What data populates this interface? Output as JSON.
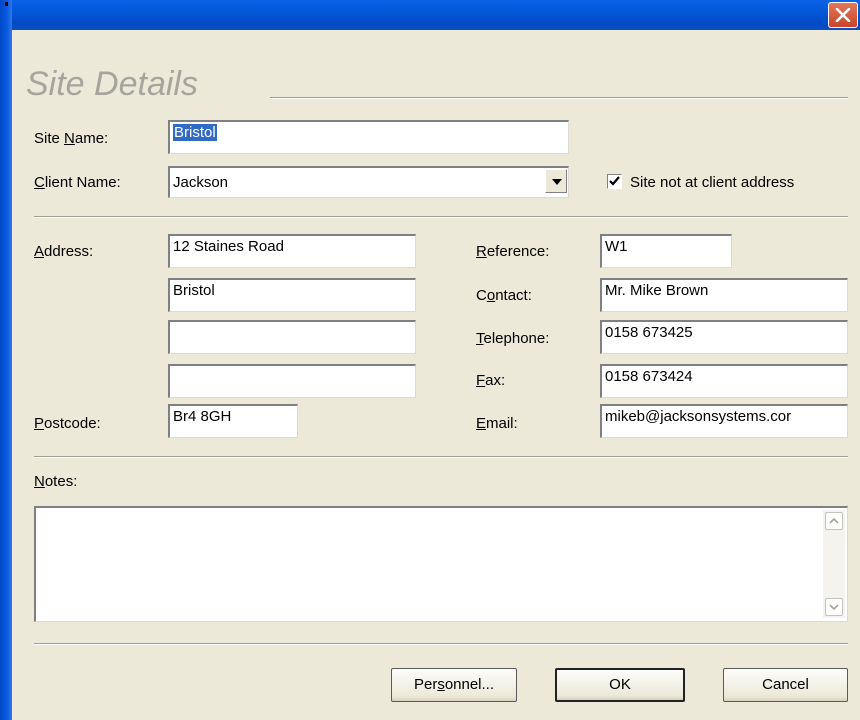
{
  "dialog": {
    "heading": "Site Details",
    "accent_color": "#0358d8",
    "close_icon": "close-icon"
  },
  "site_name": {
    "label_prefix": "Site ",
    "label_key": "N",
    "label_rest": "ame:",
    "value": "Bristol"
  },
  "client_name": {
    "label_key": "C",
    "label_rest": "lient Name:",
    "value": "Jackson",
    "icon": "chevron-down-icon"
  },
  "site_not_at_client": {
    "label": "Site not at client address",
    "checked": true
  },
  "address": {
    "label_key": "A",
    "label_rest": "ddress:",
    "lines": [
      "12 Staines Road",
      "Bristol",
      "",
      ""
    ]
  },
  "postcode": {
    "label_key": "P",
    "label_rest": "ostcode:",
    "value": "Br4 8GH"
  },
  "reference": {
    "label_key": "R",
    "label_rest": "eference:",
    "value": "W1"
  },
  "contact": {
    "label_prefix": "C",
    "label_key": "o",
    "label_rest": "ntact:",
    "value": "Mr. Mike Brown"
  },
  "telephone": {
    "label_key": "T",
    "label_rest": "elephone:",
    "value": "0158 673425"
  },
  "fax": {
    "label_key": "F",
    "label_rest": "ax:",
    "value": "0158 673424"
  },
  "email": {
    "label_key": "E",
    "label_rest": "mail:",
    "value": "mikeb@jacksonsystems.cor"
  },
  "notes": {
    "label_key": "N",
    "label_rest": "otes:",
    "value": ""
  },
  "buttons": {
    "personnel_prefix": "Per",
    "personnel_key": "s",
    "personnel_rest": "onnel...",
    "ok": "OK",
    "cancel": "Cancel"
  }
}
